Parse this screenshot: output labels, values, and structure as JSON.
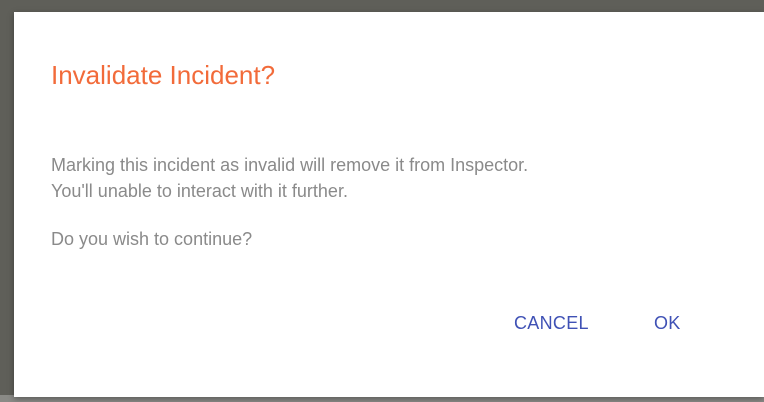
{
  "dialog": {
    "title": "Invalidate Incident?",
    "message_line_1": "Marking this incident as invalid will remove it from Inspector.",
    "message_line_2": "You'll unable to interact with it further.",
    "question": "Do you wish to continue?",
    "cancel_label": "CANCEL",
    "ok_label": "OK"
  },
  "colors": {
    "title": "#f26b3a",
    "body_text": "#8a8a8a",
    "button_text": "#3f51b5",
    "dialog_background": "#ffffff",
    "backdrop": "#5f5f59"
  }
}
